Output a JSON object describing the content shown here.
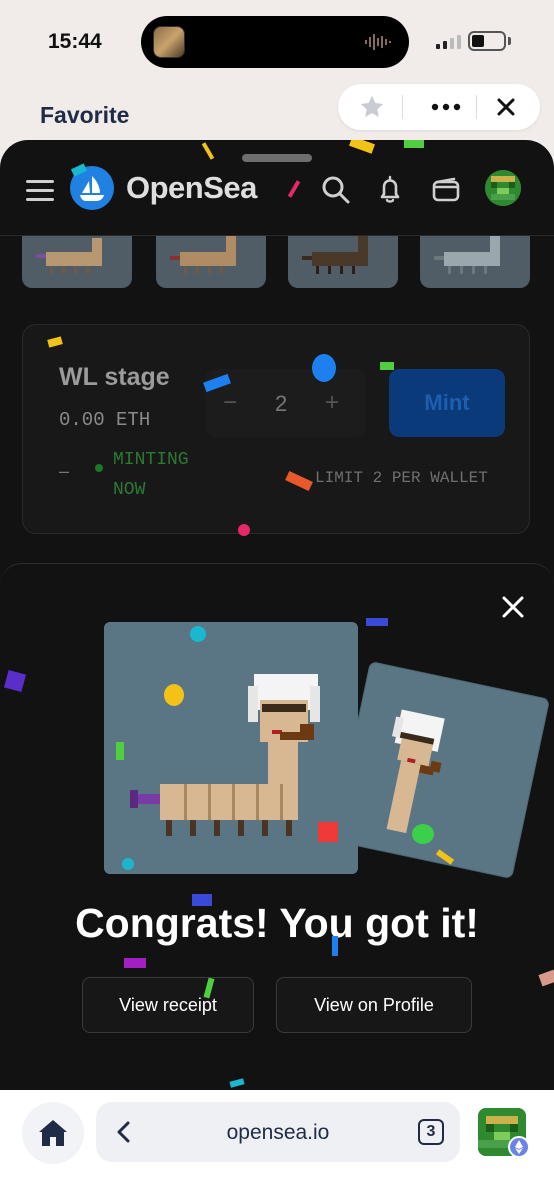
{
  "status_bar": {
    "time": "15:44"
  },
  "mini_app": {
    "title": "Favorite"
  },
  "nav": {
    "brand": "OpenSea"
  },
  "mint_card": {
    "stage": "WL stage",
    "price": "0.00 ETH",
    "dash": "–",
    "status": "MINTING NOW",
    "quantity_minus": "−",
    "quantity": "2",
    "quantity_plus": "+",
    "mint_label": "Mint",
    "limit": "LIMIT 2 PER WALLET"
  },
  "modal": {
    "headline": "Congrats! You got it!",
    "view_receipt": "View receipt",
    "view_profile": "View on Profile"
  },
  "browser": {
    "url": "opensea.io",
    "tab_count": "3"
  },
  "colors": {
    "accent": "#2081e2",
    "background_dark": "#121212",
    "nft_bg": "#5a7583"
  }
}
